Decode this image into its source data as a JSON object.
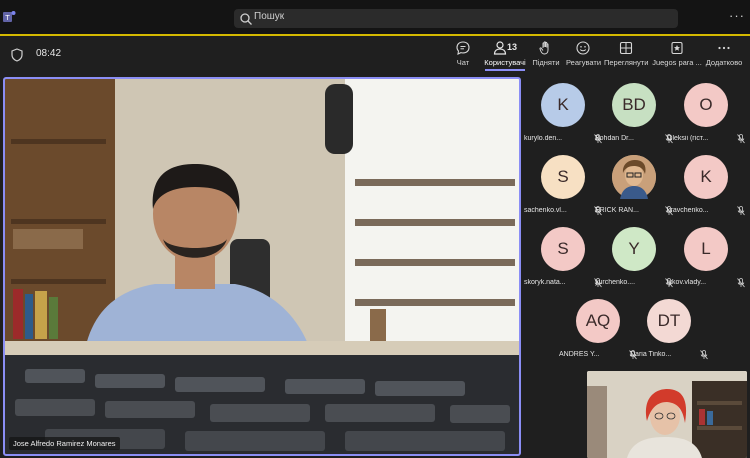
{
  "search": {
    "placeholder": "Пошук"
  },
  "meeting": {
    "timer": "08:42"
  },
  "toolbar": {
    "chat": "Чат",
    "people": "Користувачі",
    "people_count": "13",
    "raise": "Підняти",
    "react": "Реагувати",
    "view": "Переглянути",
    "apps": "Juegos para ...",
    "more": "Додатково"
  },
  "main_video": {
    "speaker_name": "Jose Alfredo Ramirez Monares"
  },
  "participants": [
    {
      "initials": "K",
      "name": "kurylo.den...",
      "color": "#b7cbe8"
    },
    {
      "initials": "BD",
      "name": "Bohdan Dr...",
      "color": "#c7e0c2"
    },
    {
      "initials": "O",
      "name": "Oleksii (гіст...",
      "color": "#f3c9c6"
    },
    {
      "initials": "S",
      "name": "sachenko.vl...",
      "color": "#f7e0c3"
    },
    {
      "initials": "",
      "name": "ERICK RAN...",
      "color": "#e8c6a0"
    },
    {
      "initials": "K",
      "name": "kravchenko...",
      "color": "#f3c9c6"
    },
    {
      "initials": "S",
      "name": "skoryk.nata...",
      "color": "#f3c9c6"
    },
    {
      "initials": "Y",
      "name": "yurchenko....",
      "color": "#cfe8c6"
    },
    {
      "initials": "L",
      "name": "lykov.vlady...",
      "color": "#f3c9c6"
    },
    {
      "initials": "AQ",
      "name": "ANDRES Y...",
      "color": "#f3c9c6"
    },
    {
      "initials": "DT",
      "name": "Daria Tinko...",
      "color": "#f3d9d4"
    }
  ]
}
